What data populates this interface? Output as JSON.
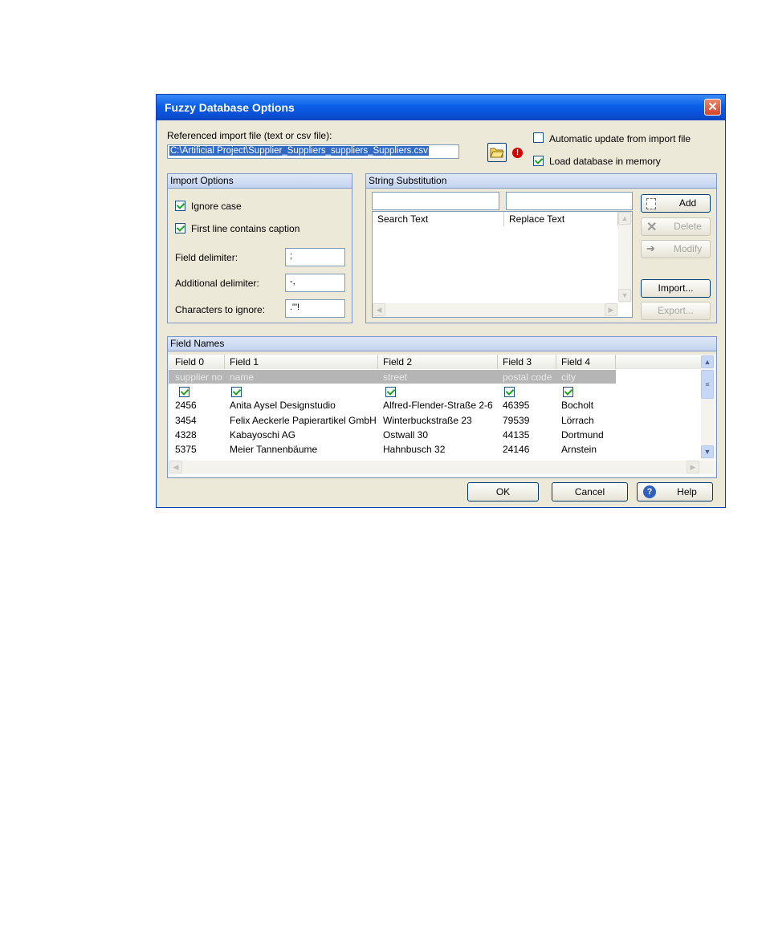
{
  "window": {
    "title": "Fuzzy Database Options",
    "close_glyph": "✕"
  },
  "import_file": {
    "label": "Referenced import file (text or csv file):",
    "path": "C:\\Artificial Project\\Supplier_Suppliers_suppliers_Suppliers.csv",
    "warning_glyph": "!"
  },
  "options": {
    "auto_update": {
      "label": "Automatic update from import file",
      "checked": false
    },
    "load_memory": {
      "label": "Load database in memory",
      "checked": true
    }
  },
  "import_options": {
    "heading": "Import Options",
    "ignore_case": {
      "label": "Ignore case",
      "checked": true
    },
    "first_line_caption": {
      "label": "First line contains caption",
      "checked": true
    },
    "field_delimiter": {
      "label": "Field delimiter:",
      "value": ";"
    },
    "additional_delimiter": {
      "label": "Additional delimiter:",
      "value": "-,"
    },
    "chars_ignore": {
      "label": "Characters to ignore:",
      "value": ".\"'!"
    }
  },
  "string_substitution": {
    "heading": "String Substitution",
    "columns": [
      "Search Text",
      "Replace Text"
    ],
    "buttons": {
      "add": "Add",
      "delete": "Delete",
      "modify": "Modify",
      "import": "Import...",
      "export": "Export..."
    }
  },
  "field_names": {
    "heading": "Field Names",
    "columns": [
      "Field 0",
      "Field 1",
      "Field 2",
      "Field 3",
      "Field 4"
    ],
    "captions": [
      "supplier no",
      "name",
      "street",
      "postal code",
      "city"
    ],
    "rows": [
      [
        "2456",
        "Anita Aysel Designstudio",
        "Alfred-Flender-Straße 2-6",
        "46395",
        "Bocholt"
      ],
      [
        "3454",
        "Felix Aeckerle Papierartikel GmbH",
        "Winterbuckstraße 23",
        "79539",
        "Lörrach"
      ],
      [
        "4328",
        "Kabayoschi AG",
        "Ostwall 30",
        "44135",
        "Dortmund"
      ],
      [
        "5375",
        "Meier Tannenbäume",
        "Hahnbusch 32",
        "24146",
        "Arnstein"
      ]
    ]
  },
  "footer": {
    "ok": "OK",
    "cancel": "Cancel",
    "help": "Help",
    "help_glyph": "?"
  },
  "colors": {
    "title_bar": "#0a5ee8",
    "selection": "#316ac5",
    "check": "#21a121",
    "warning": "#d40000"
  }
}
